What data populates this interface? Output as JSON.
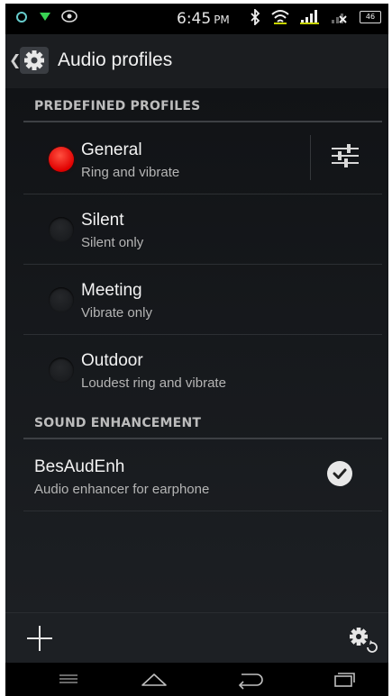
{
  "status_bar": {
    "time": "6:45",
    "ampm": "PM",
    "battery": "46"
  },
  "action_bar": {
    "title": "Audio profiles"
  },
  "predefined": {
    "header": "PREDEFINED PROFILES",
    "profiles": [
      {
        "title": "General",
        "subtitle": "Ring and vibrate",
        "selected": true
      },
      {
        "title": "Silent",
        "subtitle": "Silent only",
        "selected": false
      },
      {
        "title": "Meeting",
        "subtitle": "Vibrate only",
        "selected": false
      },
      {
        "title": "Outdoor",
        "subtitle": "Loudest ring and vibrate",
        "selected": false
      }
    ]
  },
  "enhancement": {
    "header": "SOUND ENHANCEMENT",
    "item": {
      "title": "BesAudEnh",
      "subtitle": "Audio enhancer for earphone",
      "checked": true
    }
  },
  "icons": {
    "app": "settings-gear-icon",
    "profile_settings": "equalizer-sliders-icon",
    "add": "plus-icon",
    "reset": "gear-reset-icon",
    "nav": [
      "menu-icon",
      "home-icon",
      "back-icon",
      "recent-apps-icon"
    ]
  },
  "colors": {
    "accent_selected": "#e00000",
    "background": "#111316"
  }
}
